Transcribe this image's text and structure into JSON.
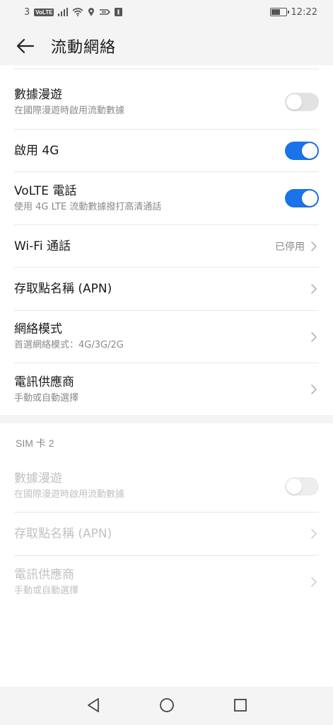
{
  "status_bar": {
    "sim_number": "3",
    "volte_badge": "VoLTE",
    "time": "12:22",
    "battery_level": 0.6,
    "icons": [
      "signal-icon",
      "wifi-icon",
      "location-icon",
      "nfc-icon",
      "notification-icon",
      "battery-icon"
    ]
  },
  "header": {
    "title": "流動網絡",
    "back_icon": "arrow-left-icon"
  },
  "sim1": {
    "rows": [
      {
        "title": "數據漫遊",
        "subtitle": "在國際漫遊時啟用流動數據",
        "control": "toggle",
        "state": "off"
      },
      {
        "title": "啟用 4G",
        "control": "toggle",
        "state": "on"
      },
      {
        "title": "VoLTE 電話",
        "subtitle": "使用 4G LTE 流動數據撥打高清通話",
        "control": "toggle",
        "state": "on"
      },
      {
        "title": "Wi-Fi 通話",
        "value": "已停用",
        "control": "chevron"
      },
      {
        "title": "存取點名稱 (APN)",
        "control": "chevron"
      },
      {
        "title": "網絡模式",
        "subtitle": "首選網絡模式：4G/3G/2G",
        "control": "chevron"
      },
      {
        "title": "電訊供應商",
        "subtitle": "手動或自動選擇",
        "control": "chevron"
      }
    ]
  },
  "sim2": {
    "section_title": "SIM 卡 2",
    "rows": [
      {
        "title": "數據漫遊",
        "subtitle": "在國際漫遊時啟用流動數據",
        "control": "toggle",
        "state": "off-disabled"
      },
      {
        "title": "存取點名稱 (APN)",
        "control": "chevron"
      },
      {
        "title": "電訊供應商",
        "subtitle": "手動或自動選擇",
        "control": "chevron"
      }
    ]
  },
  "colors": {
    "accent": "#1a73e8",
    "background": "#f4f4f4",
    "card": "#ffffff",
    "subtitle": "#8a8a8a",
    "disabled_text": "#c2c2c2"
  },
  "nav_bar": [
    "back-triangle-icon",
    "home-circle-icon",
    "recents-square-icon"
  ]
}
